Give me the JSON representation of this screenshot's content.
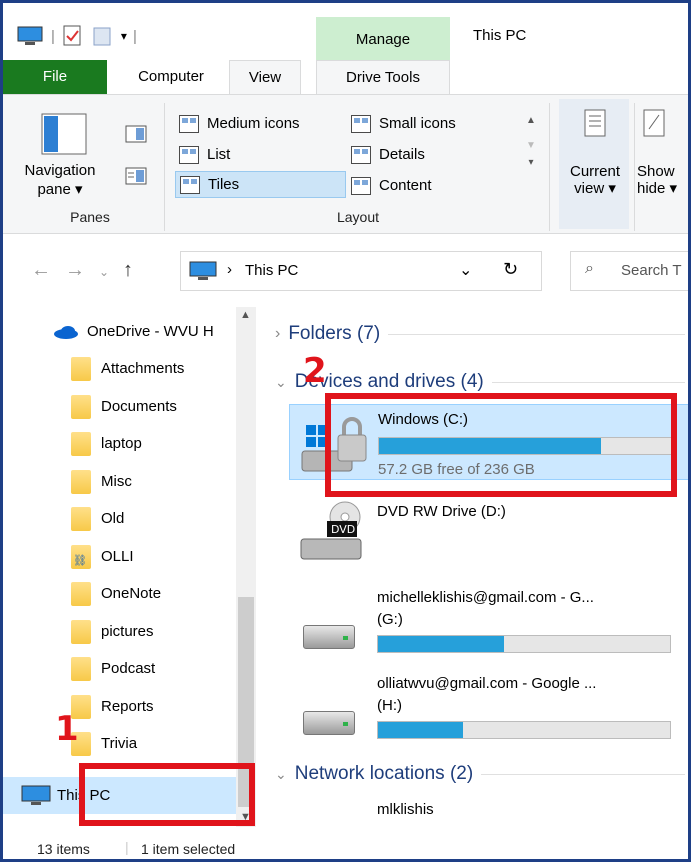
{
  "title_bar": {
    "manage_tab": "Manage",
    "window_title": "This PC"
  },
  "tabs": [
    "File",
    "Computer",
    "View",
    "Drive Tools"
  ],
  "ribbon": {
    "panes": {
      "nav_pane_label_1": "Navigation",
      "nav_pane_label_2": "pane ▾",
      "group_label": "Panes"
    },
    "layout": {
      "items": [
        "Medium icons",
        "Small icons",
        "List",
        "Details",
        "Tiles",
        "Content"
      ],
      "selected": "Tiles",
      "group_label": "Layout"
    },
    "current_view": {
      "line1": "Current",
      "line2": "view ▾"
    },
    "show_hide": {
      "line1": "Show",
      "line2": "hide ▾"
    }
  },
  "address": {
    "path": "This PC",
    "search_placeholder": "Search T"
  },
  "nav_pane": {
    "onedrive": "OneDrive - WVU H",
    "folders": [
      "Attachments",
      "Documents",
      "laptop",
      "Misc",
      "Old",
      "OLLI",
      "OneNote",
      "pictures",
      "Podcast",
      "Reports",
      "Trivia"
    ],
    "this_pc": "This PC"
  },
  "content": {
    "folders_header": "Folders (7)",
    "devices_header": "Devices and drives (4)",
    "drives": [
      {
        "name": "Windows (C:)",
        "free": "57.2 GB free of 236 GB",
        "used_fraction": 0.76
      },
      {
        "name": "DVD RW Drive (D:)",
        "dvd_label": "DVD"
      },
      {
        "name": "michelleklishis@gmail.com - G...",
        "letter": "(G:)",
        "used_fraction": 0.43
      },
      {
        "name": "olliatwvu@gmail.com - Google ...",
        "letter": "(H:)",
        "used_fraction": 0.29
      }
    ],
    "network_header": "Network locations (2)",
    "network_item": "mlklishis"
  },
  "status": {
    "items": "13 items",
    "selected": "1 item selected"
  },
  "annotations": {
    "one": "1",
    "two": "2",
    "color": "#e0141b"
  }
}
